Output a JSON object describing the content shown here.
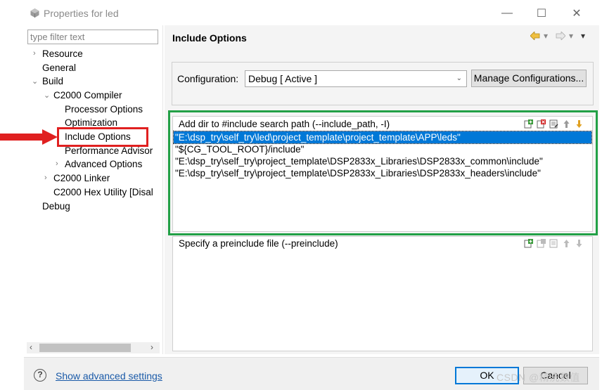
{
  "window": {
    "title": "Properties for led",
    "minimize": "—",
    "maximize": "☐",
    "close": "✕"
  },
  "filter": {
    "placeholder": "type filter text",
    "value": ""
  },
  "tree": {
    "resource": "Resource",
    "general": "General",
    "build": "Build",
    "c2000_compiler": "C2000 Compiler",
    "processor_options": "Processor Options",
    "optimization": "Optimization",
    "include_options": "Include Options",
    "performance_advisor": "Performance Advisor",
    "advanced_options": "Advanced Options",
    "c2000_linker": "C2000 Linker",
    "c2000_hex_utility": "C2000 Hex Utility  [Disal",
    "debug": "Debug"
  },
  "page": {
    "title": "Include Options",
    "configuration_label": "Configuration:",
    "configuration_value": "Debug  [ Active ]",
    "manage_button": "Manage Configurations..."
  },
  "include_paths": {
    "header": "Add dir to #include search path (--include_path, -I)",
    "items": [
      "\"E:\\dsp_try\\self_try\\led\\project_template\\project_template\\APP\\leds\"",
      "\"${CG_TOOL_ROOT}/include\"",
      "\"E:\\dsp_try\\self_try\\project_template\\DSP2833x_Libraries\\DSP2833x_common\\include\"",
      "\"E:\\dsp_try\\self_try\\project_template\\DSP2833x_Libraries\\DSP2833x_headers\\include\""
    ],
    "selected_index": 0
  },
  "preinclude": {
    "header": "Specify a preinclude file (--preinclude)"
  },
  "footer": {
    "help": "?",
    "advanced_link": "Show advanced settings",
    "ok": "OK",
    "cancel": "Cancel",
    "watermark": "CSDN @精洗数值"
  },
  "colors": {
    "selection": "#0078d7",
    "annotation_red": "#e02020",
    "annotation_green": "#22a046",
    "link": "#1a5aa8"
  }
}
